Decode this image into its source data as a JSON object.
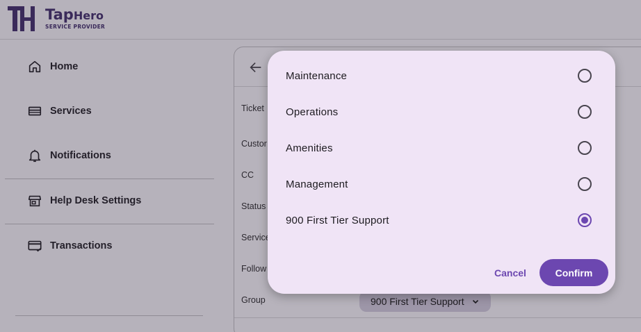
{
  "brand": {
    "mark": "TH",
    "title_big": "Tap",
    "title_small": "Hero",
    "subtitle": "SERVICE PROVIDER",
    "color": "#3a2a5a"
  },
  "sidebar": {
    "items": [
      {
        "label": "Home",
        "icon": "home-icon"
      },
      {
        "label": "Services",
        "icon": "services-icon"
      },
      {
        "label": "Notifications",
        "icon": "bell-icon"
      },
      {
        "label": "Help Desk Settings",
        "icon": "storefront-icon"
      },
      {
        "label": "Transactions",
        "icon": "card-check-icon"
      }
    ]
  },
  "form": {
    "labels": [
      "Ticket",
      "Custor",
      "CC",
      "Status",
      "Service",
      "Follow",
      "Group"
    ],
    "group_value": "900 First Tier Support"
  },
  "dialog": {
    "options": [
      {
        "label": "Maintenance",
        "selected": false
      },
      {
        "label": "Operations",
        "selected": false
      },
      {
        "label": "Amenities",
        "selected": false
      },
      {
        "label": "Management",
        "selected": false
      },
      {
        "label": "900 First Tier Support",
        "selected": true
      }
    ],
    "cancel_label": "Cancel",
    "confirm_label": "Confirm"
  },
  "colors": {
    "accent": "#6c47b0",
    "dialog_bg": "#f0e4f6",
    "scrim": "#b6b2bb"
  }
}
